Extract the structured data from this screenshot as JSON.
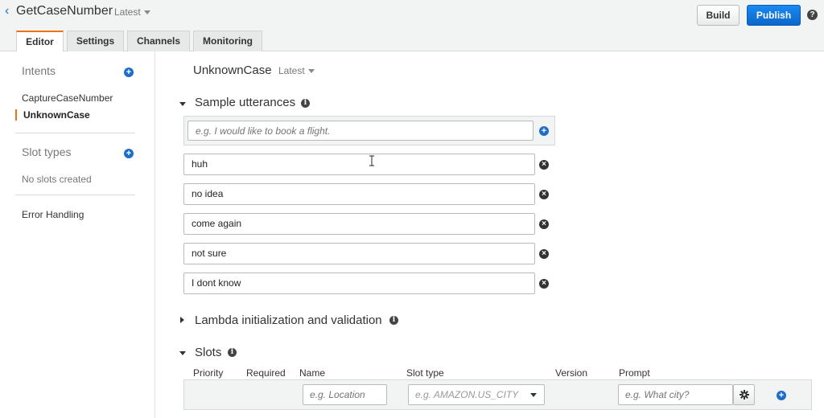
{
  "header": {
    "back_glyph": "‹",
    "bot_name": "GetCaseNumber",
    "bot_version": "Latest",
    "build_label": "Build",
    "publish_label": "Publish",
    "help_glyph": "?"
  },
  "tabs": [
    {
      "label": "Editor"
    },
    {
      "label": "Settings"
    },
    {
      "label": "Channels"
    },
    {
      "label": "Monitoring"
    }
  ],
  "sidebar": {
    "intents_heading": "Intents",
    "intents": [
      {
        "label": "CaptureCaseNumber"
      },
      {
        "label": "UnknownCase"
      }
    ],
    "slot_types_heading": "Slot types",
    "no_slots_text": "No slots created",
    "error_handling_label": "Error Handling"
  },
  "main": {
    "intent_name": "UnknownCase",
    "intent_version": "Latest",
    "sample_utterances_title": "Sample utterances",
    "new_utterance_placeholder": "e.g. I would like to book a flight.",
    "utterances": [
      {
        "text": "huh"
      },
      {
        "text": "no idea"
      },
      {
        "text": "come again"
      },
      {
        "text": "not sure"
      },
      {
        "text": "I dont know"
      }
    ],
    "lambda_title": "Lambda initialization and validation",
    "slots_title": "Slots",
    "slot_columns": [
      "Priority",
      "Required",
      "Name",
      "Slot type",
      "Version",
      "Prompt"
    ],
    "name_placeholder": "e.g. Location",
    "slot_type_placeholder": "e.g. AMAZON.US_CITY",
    "prompt_placeholder": "e.g. What city?"
  },
  "icons": {
    "plus": "+",
    "remove": "×",
    "info": "i"
  },
  "colors": {
    "accent_orange": "#ec7211",
    "primary_blue": "#1e6ec8",
    "publish_blue": "#0b66c8"
  }
}
